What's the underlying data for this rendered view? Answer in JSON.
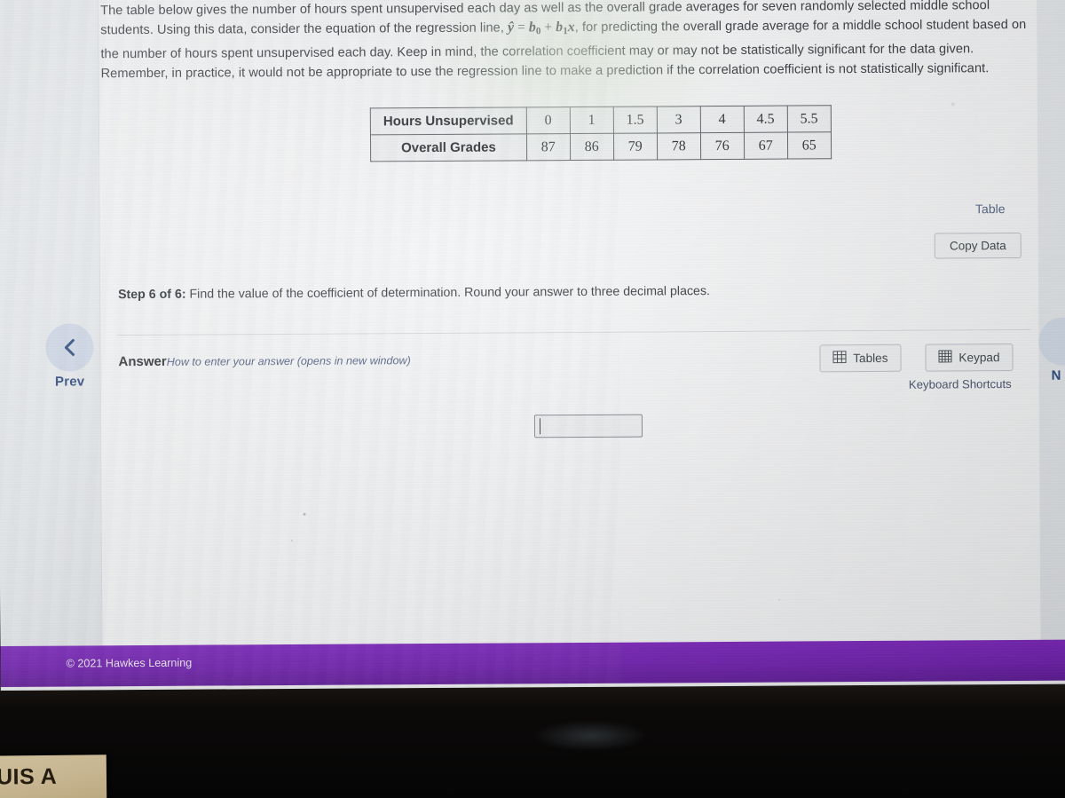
{
  "screen": {
    "prompt": {
      "part1": "The table below gives the number of hours spent unsupervised each day as well as the overall grade averages for seven randomly selected middle school students. Using this data, consider the equation of the regression line, ",
      "equation_yhat": "ŷ",
      "equation_eq": " = ",
      "equation_b0": "b",
      "equation_b0_sub": "0",
      "equation_plus": " + ",
      "equation_b1": "b",
      "equation_b1_sub": "1",
      "equation_x": "x",
      "part2": ", for predicting the overall grade average for a middle school student based on the number of hours spent unsupervised each day. Keep in mind, the correlation coefficient may or may not be statistically significant for the data given. Remember, in practice, it would not be appropriate to use the regression line to make a prediction if the correlation coefficient is not statistically significant."
    },
    "table": {
      "row_labels": [
        "Hours Unsupervised",
        "Overall Grades"
      ],
      "hours_unsupervised": [
        "0",
        "1",
        "1.5",
        "3",
        "4",
        "4.5",
        "5.5"
      ],
      "overall_grades": [
        "87",
        "86",
        "79",
        "78",
        "76",
        "67",
        "65"
      ],
      "link_label": "Table",
      "copy_data_label": "Copy Data"
    },
    "step": {
      "label": "Step 6 of 6:",
      "text": " Find the value of the coefficient of determination. Round your answer to three decimal places."
    },
    "answer": {
      "label": "Answer",
      "help_link": "How to enter your answer (opens in new window)",
      "input_value": "",
      "input_placeholder": ""
    },
    "tools": {
      "tables_label": "Tables",
      "keypad_label": "Keypad",
      "keyboard_shortcuts_label": "Keyboard Shortcuts"
    },
    "nav": {
      "prev_label": "Prev",
      "next_label": "N"
    },
    "footer": {
      "copyright": "© 2021 Hawkes Learning"
    }
  },
  "desktop": {
    "sticky_note_text": "UIS A"
  },
  "colors": {
    "footer_purple": "#6f1db0",
    "link_blue": "#4a5b7d",
    "nav_blue": "#1f3f77",
    "page_bg": "#f4f5f6",
    "rail_bg": "#e7eaed",
    "sticky_note": "#c6b590"
  }
}
